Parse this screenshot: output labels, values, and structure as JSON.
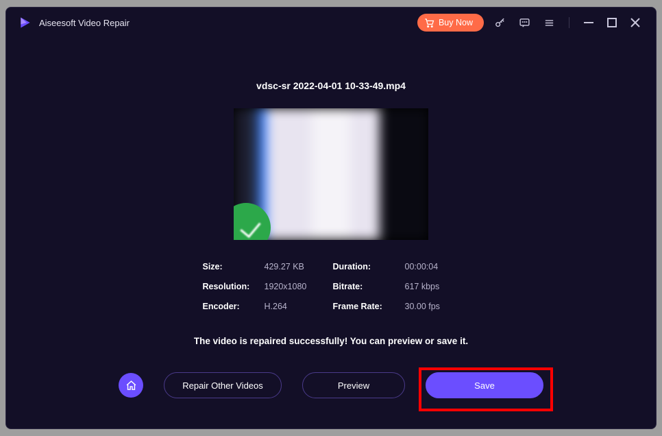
{
  "app": {
    "title": "Aiseesoft Video Repair"
  },
  "titlebar": {
    "buy_label": "Buy Now"
  },
  "file": {
    "name": "vdsc-sr 2022-04-01 10-33-49.mp4"
  },
  "meta": {
    "size_label": "Size:",
    "size_value": "429.27 KB",
    "duration_label": "Duration:",
    "duration_value": "00:00:04",
    "resolution_label": "Resolution:",
    "resolution_value": "1920x1080",
    "bitrate_label": "Bitrate:",
    "bitrate_value": "617 kbps",
    "encoder_label": "Encoder:",
    "encoder_value": "H.264",
    "framerate_label": "Frame Rate:",
    "framerate_value": "30.00 fps"
  },
  "status": {
    "message": "The video is repaired successfully! You can preview or save it."
  },
  "buttons": {
    "repair_other": "Repair Other Videos",
    "preview": "Preview",
    "save": "Save"
  }
}
